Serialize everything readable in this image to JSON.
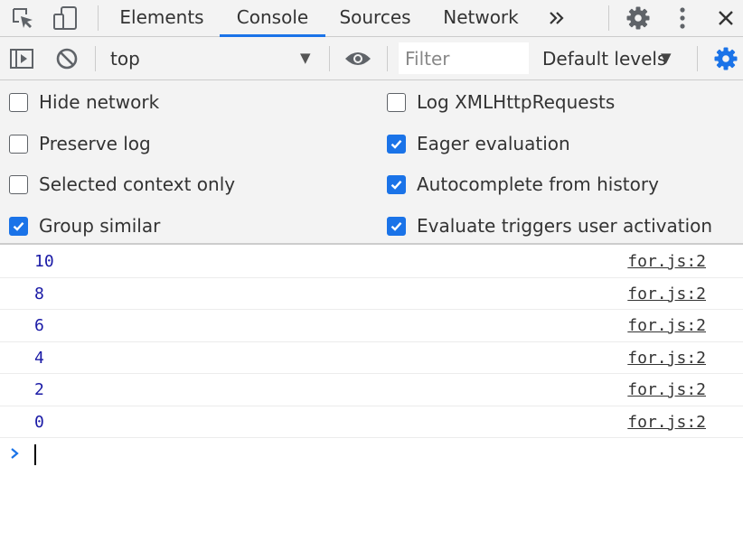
{
  "tabs": [
    {
      "label": "Elements"
    },
    {
      "label": "Console",
      "active": true
    },
    {
      "label": "Sources"
    },
    {
      "label": "Network"
    }
  ],
  "toolbar": {
    "context": "top",
    "filter_placeholder": "Filter",
    "levels": "Default levels"
  },
  "settings": {
    "left": [
      {
        "label": "Hide network",
        "checked": false
      },
      {
        "label": "Preserve log",
        "checked": false
      },
      {
        "label": "Selected context only",
        "checked": false
      },
      {
        "label": "Group similar",
        "checked": true
      }
    ],
    "right": [
      {
        "label": "Log XMLHttpRequests",
        "checked": false
      },
      {
        "label": "Eager evaluation",
        "checked": true
      },
      {
        "label": "Autocomplete from history",
        "checked": true
      },
      {
        "label": "Evaluate triggers user activation",
        "checked": true
      }
    ]
  },
  "messages": [
    {
      "value": "10",
      "source": "for.js:2"
    },
    {
      "value": "8",
      "source": "for.js:2"
    },
    {
      "value": "6",
      "source": "for.js:2"
    },
    {
      "value": "4",
      "source": "for.js:2"
    },
    {
      "value": "2",
      "source": "for.js:2"
    },
    {
      "value": "0",
      "source": "for.js:2"
    }
  ],
  "colors": {
    "accent": "#1a73e8",
    "message_value": "#1a1aa6",
    "panel_background": "#f3f3f3"
  },
  "icons": {
    "inspect": "inspect-element-icon",
    "device": "device-toolbar-icon",
    "more_tabs": "chevron-double-right-icon",
    "settings": "gear-icon",
    "menu": "kebab-menu-icon",
    "close": "close-icon",
    "sidebar": "sidebar-toggle-icon",
    "clear": "clear-console-icon",
    "live_expression": "eye-icon",
    "console_settings": "gear-icon"
  }
}
